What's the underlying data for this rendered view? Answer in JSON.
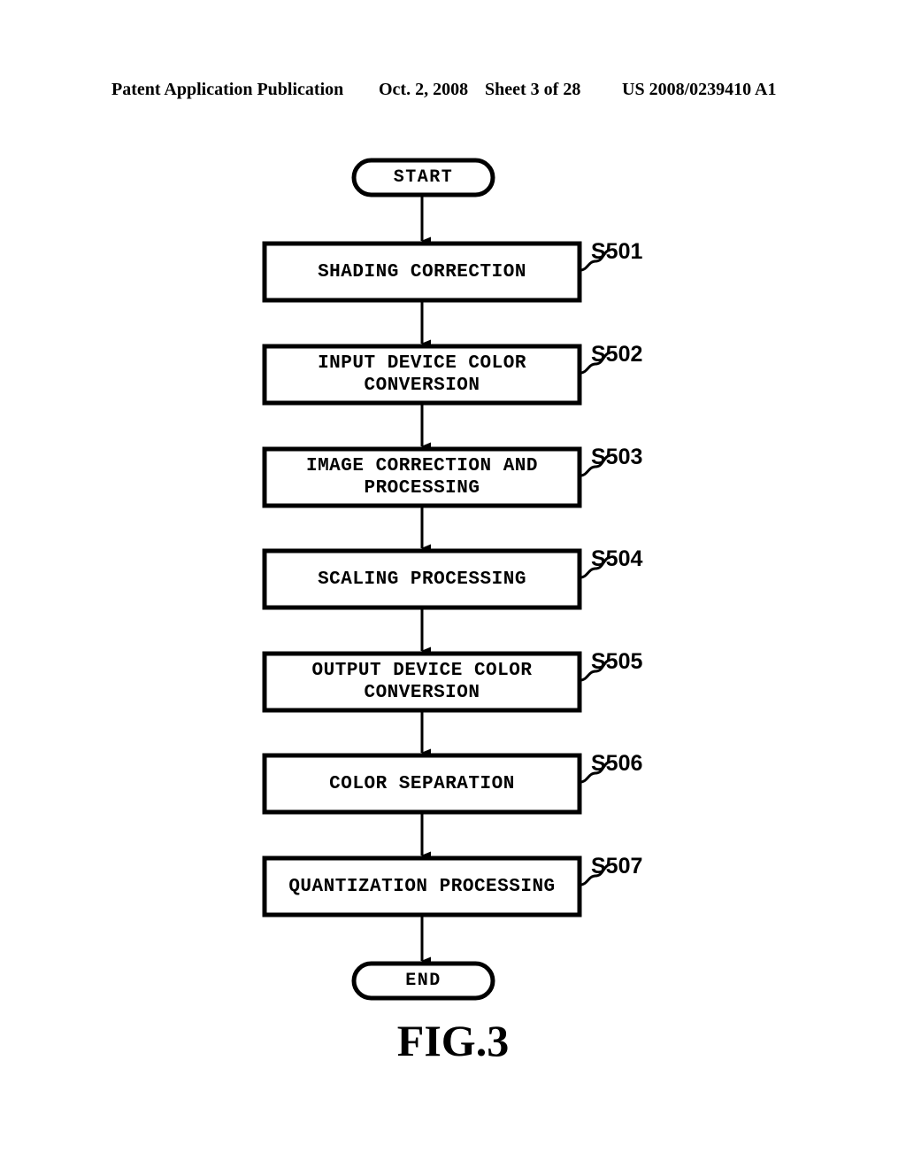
{
  "header": {
    "publication": "Patent Application Publication",
    "date": "Oct. 2, 2008",
    "sheet": "Sheet 3 of 28",
    "number": "US 2008/0239410 A1"
  },
  "figure": {
    "caption": "FIG.3"
  },
  "flowchart": {
    "start_label": "START",
    "end_label": "END",
    "steps": [
      {
        "id": "S501",
        "label": "SHADING CORRECTION"
      },
      {
        "id": "S502",
        "label": "INPUT DEVICE COLOR\nCONVERSION"
      },
      {
        "id": "S503",
        "label": "IMAGE CORRECTION AND\nPROCESSING"
      },
      {
        "id": "S504",
        "label": "SCALING PROCESSING"
      },
      {
        "id": "S505",
        "label": "OUTPUT DEVICE COLOR\nCONVERSION"
      },
      {
        "id": "S506",
        "label": "COLOR SEPARATION"
      },
      {
        "id": "S507",
        "label": "QUANTIZATION PROCESSING"
      }
    ]
  }
}
